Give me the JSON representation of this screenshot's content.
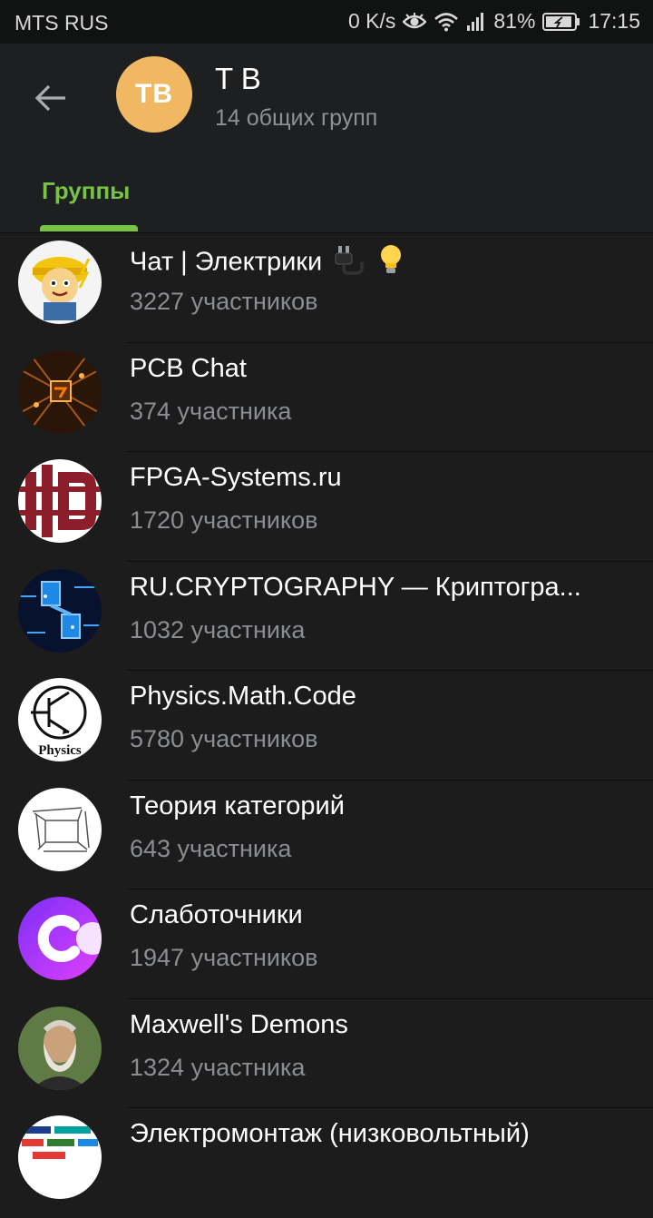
{
  "status_bar": {
    "carrier": "MTS RUS",
    "speed": "0 K/s",
    "battery": "81%",
    "time": "17:15"
  },
  "header": {
    "avatar_initials": "TB",
    "title": "T B",
    "subtitle": "14 общих групп"
  },
  "tabs": [
    {
      "label": "Группы",
      "active": true
    }
  ],
  "groups": [
    {
      "name": "Чат | Электрики",
      "count": "3227 участников",
      "avatar": "electrician-mascot"
    },
    {
      "name": "PCB Chat",
      "count": "374 участника",
      "avatar": "circuit-board"
    },
    {
      "name": "FPGA-Systems.ru",
      "count": "1720 участников",
      "avatar": "fpga-logo"
    },
    {
      "name": "RU.CRYPTOGRAPHY — Криптогра...",
      "count": "1032 участника",
      "avatar": "crypto-chip"
    },
    {
      "name": "Physics.Math.Code",
      "count": "5780 участников",
      "avatar": "transistor-logo",
      "avatar_text": "Physics"
    },
    {
      "name": "Теория категорий",
      "count": "643 участника",
      "avatar": "commutative-diagram"
    },
    {
      "name": "Слаботочники",
      "count": "1947 участников",
      "avatar": "c-logo"
    },
    {
      "name": "Maxwell's Demons",
      "count": "1324 участника",
      "avatar": "maxwell-portrait"
    },
    {
      "name": "Электромонтаж (низковольтный)",
      "count": "",
      "avatar": "brands-collage"
    }
  ],
  "colors": {
    "accent": "#78c346",
    "background": "#1c1c1d",
    "avatar_main": "#f0b862"
  }
}
